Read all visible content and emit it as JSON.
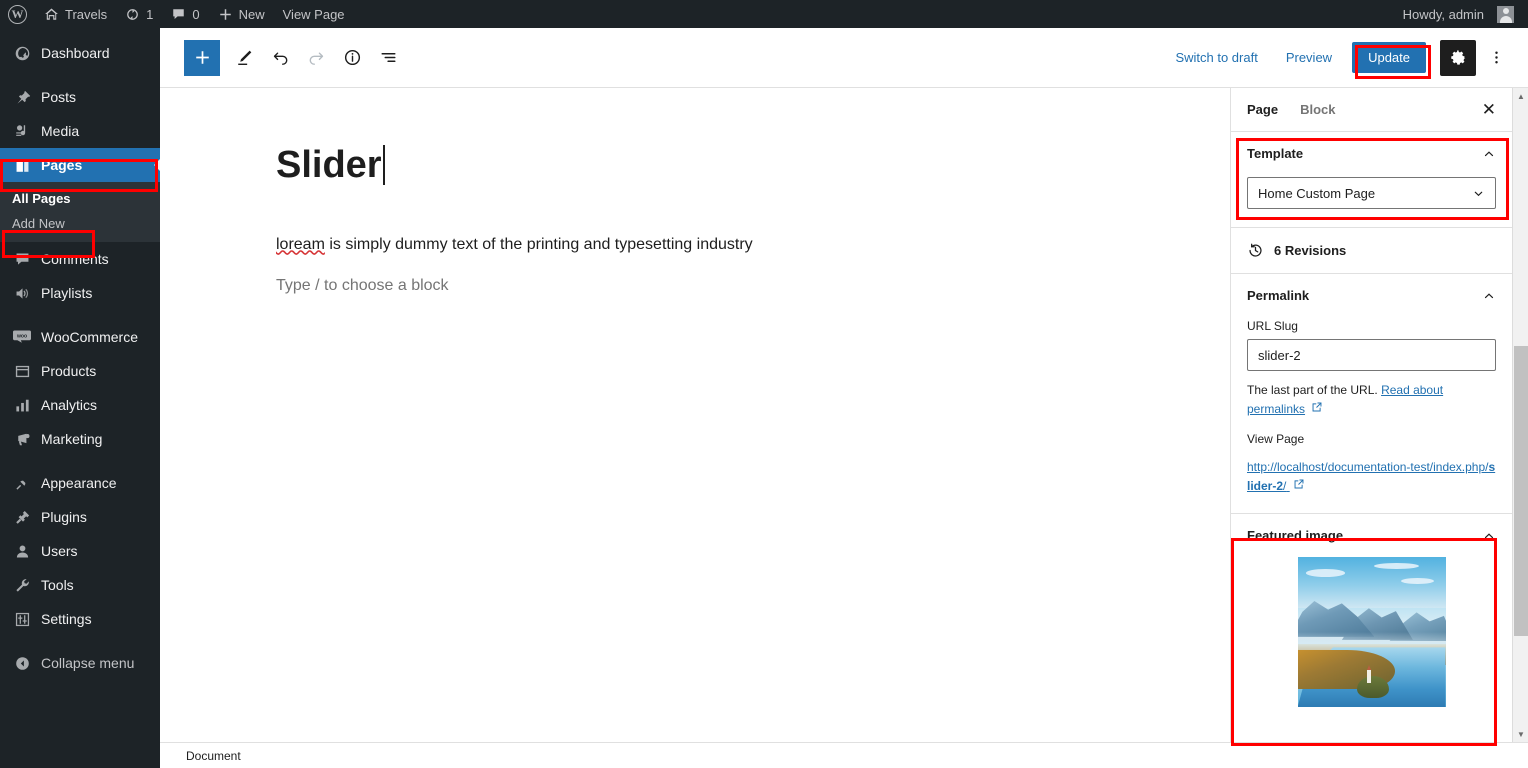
{
  "adminbar": {
    "logo_icon": "wordpress-logo-icon",
    "site_icon": "home-icon",
    "site_name": "Travels",
    "updates_icon": "updates-refresh-icon",
    "updates_count": "1",
    "comments_icon": "comment-bubble-icon",
    "comments_count": "0",
    "new_icon": "plus-icon",
    "new_label": "New",
    "view_page_label": "View Page",
    "account_greeting": "Howdy, admin",
    "avatar_icon": "user-avatar-icon"
  },
  "sidebar": {
    "items": [
      {
        "label": "Dashboard",
        "icon": "dashboard-icon"
      },
      {
        "label": "Posts",
        "icon": "pin-icon"
      },
      {
        "label": "Media",
        "icon": "media-icon"
      },
      {
        "label": "Pages",
        "icon": "pages-icon"
      },
      {
        "label": "Comments",
        "icon": "comment-icon"
      },
      {
        "label": "Playlists",
        "icon": "speaker-icon"
      },
      {
        "label": "WooCommerce",
        "icon": "woocommerce-icon"
      },
      {
        "label": "Products",
        "icon": "products-icon"
      },
      {
        "label": "Analytics",
        "icon": "analytics-bar-icon"
      },
      {
        "label": "Marketing",
        "icon": "megaphone-icon"
      },
      {
        "label": "Appearance",
        "icon": "paintbrush-icon"
      },
      {
        "label": "Plugins",
        "icon": "plug-icon"
      },
      {
        "label": "Users",
        "icon": "user-icon"
      },
      {
        "label": "Tools",
        "icon": "wrench-icon"
      },
      {
        "label": "Settings",
        "icon": "sliders-icon"
      }
    ],
    "submenu": [
      {
        "label": "All Pages"
      },
      {
        "label": "Add New"
      }
    ],
    "collapse_label": "Collapse menu",
    "collapse_icon": "collapse-arrow-icon",
    "active_item": "Pages",
    "active_bg": "#2271b1"
  },
  "toolbar": {
    "add_block_icon": "plus-icon",
    "edit_icon": "pencil-icon",
    "undo_icon": "undo-arrow-icon",
    "redo_icon": "redo-arrow-icon",
    "info_icon": "info-circle-icon",
    "list_view_icon": "list-view-icon",
    "switch_to_draft_label": "Switch to draft",
    "preview_label": "Preview",
    "update_label": "Update",
    "settings_gear_icon": "gear-icon",
    "more_options_icon": "three-dots-vertical-icon",
    "accent_color": "#2271b1"
  },
  "editor": {
    "title": "Slider",
    "paragraph_spelled_word": "loream",
    "paragraph_rest": " is simply dummy text of the printing and typesetting industry",
    "block_placeholder": "Type / to choose a block"
  },
  "settings_panel": {
    "tab_page": "Page",
    "tab_block": "Block",
    "close_icon": "close-x-icon",
    "template": {
      "heading": "Template",
      "chevron_icon": "chevron-up-icon",
      "selected_value": "Home Custom Page",
      "select_chevron_icon": "chevron-down-icon"
    },
    "revisions": {
      "icon": "revision-clock-icon",
      "label": "6 Revisions"
    },
    "permalink": {
      "heading": "Permalink",
      "chevron_icon": "chevron-up-icon",
      "url_slug_label": "URL Slug",
      "url_slug_value": "slider-2",
      "helper_text": "The last part of the URL. ",
      "helper_link": "Read about permalinks",
      "external_icon": "external-link-icon",
      "view_page_label": "View Page",
      "full_url_prefix": "http://localhost/documentation-test/index.php/",
      "full_url_slug": "slider-2",
      "full_url_suffix": "/"
    },
    "featured_image": {
      "heading": "Featured image",
      "chevron_icon": "chevron-up-icon",
      "image_alt": "mountain-lake-island-photo"
    }
  },
  "bottombar": {
    "breadcrumb": "Document"
  },
  "annotations": {
    "highlight_color": "#ff0000",
    "boxes": [
      "pages-menu-item",
      "add-new-submenu-item",
      "update-button",
      "template-panel",
      "featured-image-panel"
    ]
  }
}
